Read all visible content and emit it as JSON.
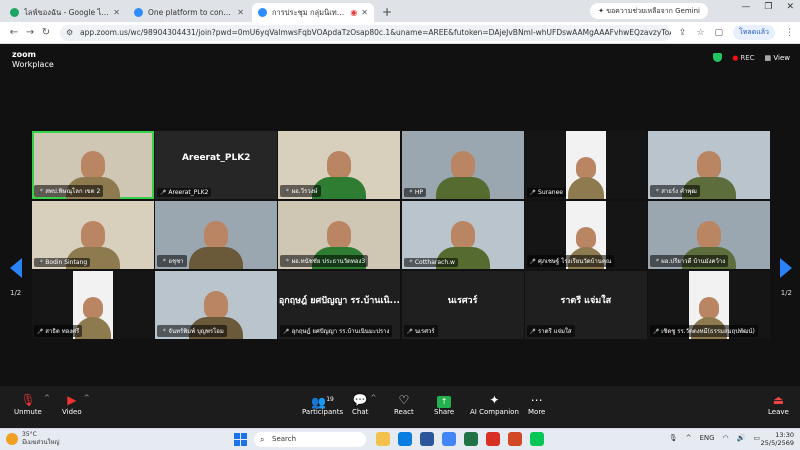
{
  "browser": {
    "tabs": [
      {
        "title": "ไลฟ์ของฉัน - Google ไดรฟ์",
        "color": "#1fa463",
        "active": false
      },
      {
        "title": "One platform to connect | Zoom",
        "color": "#2d8cff",
        "active": false
      },
      {
        "title": "การประชุม กลุ่มนิเทศฯ งานสถา...",
        "color": "#2d8cff",
        "active": true
      }
    ],
    "gemini_label": "ขอความช่วยเหลือจาก Gemini",
    "url": "app.zoom.us/wc/98904304431/join?pwd=0mU6yqValmwsFqbVOApdaTzOsap80c.1&uname=AREE&futoken=DAjeJvBNml-whUFDswAAMgAAAFvhwEQzavzyToABK8lVewpkPv3xF...",
    "profile_label": "โหลดแล้ว"
  },
  "zoom": {
    "logo_line1": "zoom",
    "logo_line2": "Workplace",
    "rec_label": "REC",
    "view_label": "View",
    "page_left": "1/2",
    "page_right": "1/2",
    "participants": [
      {
        "name": "สพป.พิษณุโลก เขต 2",
        "big": "",
        "kind": "person",
        "speaking": true
      },
      {
        "name": "Areerat_PLK2",
        "big": "Areerat_PLK2",
        "kind": "name"
      },
      {
        "name": "ผอ.วีรวงษ์",
        "big": "",
        "kind": "person"
      },
      {
        "name": "HP",
        "big": "",
        "kind": "person"
      },
      {
        "name": "Suranee",
        "big": "",
        "kind": "narrow"
      },
      {
        "name": "สาธร์ง คำพุฒ",
        "big": "",
        "kind": "person"
      },
      {
        "name": "Bodin Sintang",
        "big": "",
        "kind": "person"
      },
      {
        "name": "อชุชา",
        "big": "",
        "kind": "person"
      },
      {
        "name": "ผอ.ทนัชชัย ประธานวัดทอง3",
        "big": "",
        "kind": "person"
      },
      {
        "name": "Cottharach.w",
        "big": "",
        "kind": "person"
      },
      {
        "name": "ศุภเชษฐ์ โรงเรียนวัดบ้านคุณ",
        "big": "",
        "kind": "narrow"
      },
      {
        "name": "ผอ.ปรียาวดี บ้านมังคว้าง",
        "big": "",
        "kind": "person"
      },
      {
        "name": "สาธิต ทองศรี",
        "big": "",
        "kind": "narrow"
      },
      {
        "name": "จันทร์พิมพ์ บุญพรโอม",
        "big": "",
        "kind": "person"
      },
      {
        "name": "อุกฤษฎ์ ยศปัญญา รร.บ้านเนินมะปราง",
        "big": "อุกฤษฎ์ ยศปัญญา รร.บ้านเนิ...",
        "kind": "name"
      },
      {
        "name": "นเรศวร์",
        "big": "นเรศวร์",
        "kind": "name"
      },
      {
        "name": "ราตรี แจ่มใส",
        "big": "ราตรี แจ่มใส",
        "kind": "name"
      },
      {
        "name": "เชิดชู รร.วัดดงหมี(ธรรมสมฤปพัฒน์)",
        "big": "",
        "kind": "narrow"
      }
    ],
    "toolbar": {
      "unmute": "Unmute",
      "video": "Video",
      "participants": "Participants",
      "participants_count": "19",
      "chat": "Chat",
      "react": "React",
      "share": "Share",
      "ai": "AI Companion",
      "more": "More",
      "leave": "Leave"
    }
  },
  "taskbar": {
    "temp": "35°C",
    "weather": "มีเมฆส่วนใหญ่",
    "search": "Search",
    "lang": "ENG",
    "time": "13:30",
    "date": "25/5/2569"
  }
}
